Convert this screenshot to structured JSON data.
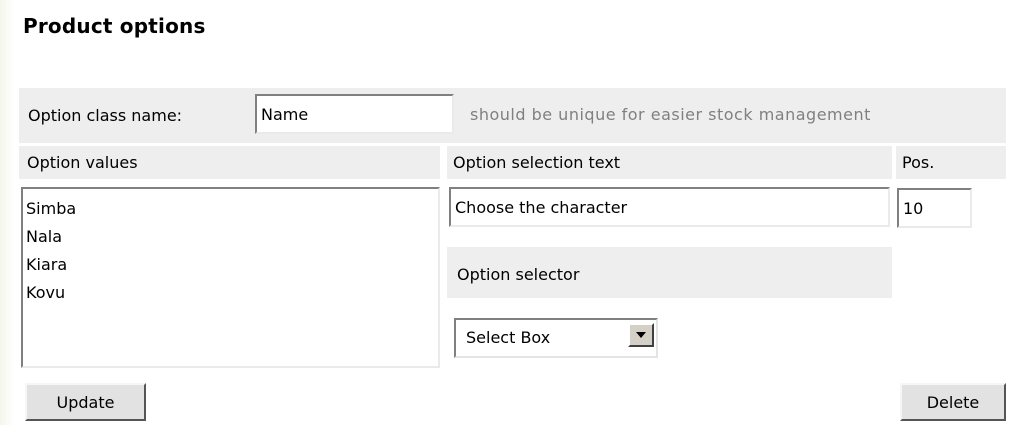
{
  "page": {
    "title": "Product options"
  },
  "option_class": {
    "label": "Option class name:",
    "value": "Name",
    "hint": "should be unique for easier stock management"
  },
  "headers": {
    "values": "Option values",
    "selection_text": "Option selection text",
    "position": "Pos."
  },
  "option_values": {
    "items": [
      "Simba",
      "Nala",
      "Kiara",
      "Kovu"
    ]
  },
  "selection_text": {
    "value": "Choose the character"
  },
  "position": {
    "value": "10"
  },
  "selector": {
    "label": "Option selector",
    "selected": "Select Box"
  },
  "buttons": {
    "update": "Update",
    "delete": "Delete"
  },
  "colors": {
    "row_background": "#eeeeee",
    "hint_text": "#808080",
    "button_face": "#e2e2e2"
  }
}
